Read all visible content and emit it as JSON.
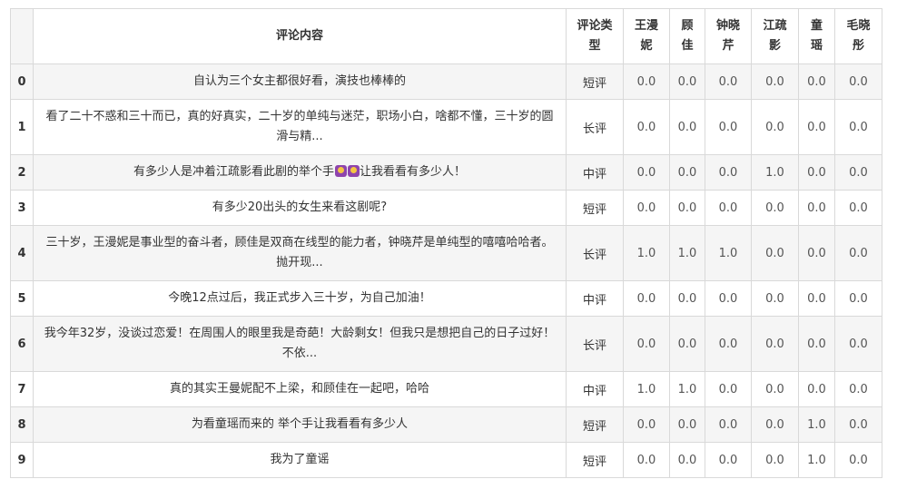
{
  "table": {
    "headers": [
      "评论内容",
      "评论类型",
      "王漫妮",
      "顾佳",
      "钟晓芹",
      "江疏影",
      "童瑶",
      "毛晓彤"
    ],
    "header_lines": [
      [
        "评论内容"
      ],
      [
        "评论类",
        "型"
      ],
      [
        "王漫",
        "妮"
      ],
      [
        "顾",
        "佳"
      ],
      [
        "钟晓",
        "芹"
      ],
      [
        "江疏",
        "影"
      ],
      [
        "童",
        "瑶"
      ],
      [
        "毛晓",
        "彤"
      ]
    ],
    "rows": [
      {
        "index": "0",
        "content": "自认为三个女主都很好看，演技也棒棒的",
        "type": "短评",
        "values": [
          "0.0",
          "0.0",
          "0.0",
          "0.0",
          "0.0",
          "0.0"
        ]
      },
      {
        "index": "1",
        "content": "看了二十不惑和三十而已，真的好真实，二十岁的单纯与迷茫，职场小白，啥都不懂，三十岁的圆滑与精...",
        "type": "长评",
        "values": [
          "0.0",
          "0.0",
          "0.0",
          "0.0",
          "0.0",
          "0.0"
        ]
      },
      {
        "index": "2",
        "content_before": "有多少人是冲着江疏影看此剧的举个手",
        "content_after": "让我看看有多少人！",
        "emoji_count": 2,
        "emoji_name": "raising-hand-emoji",
        "type": "中评",
        "values": [
          "0.0",
          "0.0",
          "0.0",
          "1.0",
          "0.0",
          "0.0"
        ]
      },
      {
        "index": "3",
        "content": "有多少20出头的女生来看这剧呢?",
        "type": "短评",
        "values": [
          "0.0",
          "0.0",
          "0.0",
          "0.0",
          "0.0",
          "0.0"
        ]
      },
      {
        "index": "4",
        "content": "三十岁，王漫妮是事业型的奋斗者，顾佳是双商在线型的能力者，钟晓芹是单纯型的嘻嘻哈哈者。抛开现...",
        "type": "长评",
        "values": [
          "1.0",
          "1.0",
          "1.0",
          "0.0",
          "0.0",
          "0.0"
        ]
      },
      {
        "index": "5",
        "content": "今晚12点过后，我正式步入三十岁，为自己加油！",
        "type": "中评",
        "values": [
          "0.0",
          "0.0",
          "0.0",
          "0.0",
          "0.0",
          "0.0"
        ]
      },
      {
        "index": "6",
        "content": "我今年32岁，没谈过恋爱！在周围人的眼里我是奇葩！大龄剩女！但我只是想把自己的日子过好！不依...",
        "type": "长评",
        "values": [
          "0.0",
          "0.0",
          "0.0",
          "0.0",
          "0.0",
          "0.0"
        ]
      },
      {
        "index": "7",
        "content": "真的其实王曼妮配不上梁，和顾佳在一起吧，哈哈",
        "type": "中评",
        "values": [
          "1.0",
          "1.0",
          "0.0",
          "0.0",
          "0.0",
          "0.0"
        ]
      },
      {
        "index": "8",
        "content": "为看童瑶而来的 举个手让我看看有多少人",
        "type": "短评",
        "values": [
          "0.0",
          "0.0",
          "0.0",
          "0.0",
          "1.0",
          "0.0"
        ]
      },
      {
        "index": "9",
        "content": "我为了童谣",
        "type": "短评",
        "values": [
          "0.0",
          "0.0",
          "0.0",
          "0.0",
          "1.0",
          "0.0"
        ]
      }
    ]
  }
}
